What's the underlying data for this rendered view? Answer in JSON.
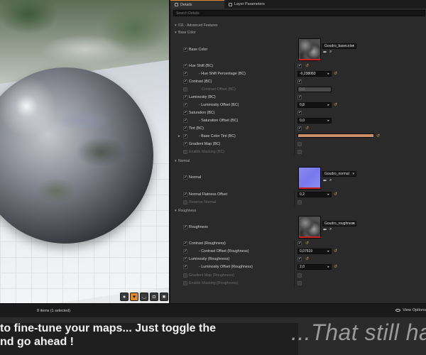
{
  "tabs": {
    "details": "Details",
    "layer_parameters": "Layer Parameters"
  },
  "search": {
    "placeholder": "Search Details"
  },
  "group_header": "011 - Advanced Features",
  "sections": {
    "base_color": "Base Color",
    "normal": "Normal",
    "roughness": "Roughness"
  },
  "base_color_rows": {
    "base_color": "Base Color",
    "asset": "Goudro_basecolor",
    "hue_shift": "Hue Shift (BC)",
    "hue_shift_pct": "- Hue Shift Percentage (BC)",
    "hue_shift_pct_value": "-0,238083",
    "contrast": "Contrast (BC)",
    "contrast_offset": "Contrast Offset (BC)",
    "contrast_offset_value": "0,0",
    "luminosity": "Luminosity (BC)",
    "luminosity_offset": "- Luminosity Offset (BC)",
    "luminosity_offset_value": "0,8",
    "saturation": "Saturation (BC)",
    "saturation_offset": "- Saturation Offset (BC)",
    "saturation_offset_value": "0,0",
    "tint": "Tint (BC)",
    "base_color_tint": "- Base Color Tint (BC)",
    "tint_color": "#c98f6b",
    "gradient_map": "Gradient Map (BC)",
    "enable_masking": "Enable Masking (BC)"
  },
  "normal_rows": {
    "normal": "Normal",
    "asset": "Goudro_normal",
    "flatness": "Normal Flatness Offset",
    "flatness_value": "0,2",
    "reverse": "Reverse Normal"
  },
  "roughness_rows": {
    "roughness": "Roughness",
    "asset": "Goudro_roughness",
    "contrast": "Contrast (Roughness)",
    "contrast_offset": "- Contrast Offset (Roughness)",
    "contrast_offset_value": "0,07619",
    "luminosity": "Luminosity (Roughness)",
    "luminosity_offset": "- Luminosity Offset (Roughness)",
    "luminosity_offset_value": "2,0",
    "gradient_map": "Gradient Map (Roughness)",
    "enable_masking": "Enable Masking (Roughness)"
  },
  "status": {
    "items": "8 items (1 selected)",
    "view_options": "View Options"
  },
  "subtitle": {
    "line1": "to fine-tune your maps... Just toggle the",
    "line2": "nd go ahead !",
    "right": "...That still ha"
  },
  "colors": {
    "accent": "#e08a2c",
    "reset_arrow": "#e0a030",
    "panel_bg": "#2a2a2a"
  },
  "icons": [
    "details-tab-icon",
    "layer-tab-icon",
    "checkbox-icon",
    "reset-arrow-icon",
    "browse-arrow-icon",
    "search-asset-icon",
    "eye-icon",
    "lit-mode-icon"
  ]
}
